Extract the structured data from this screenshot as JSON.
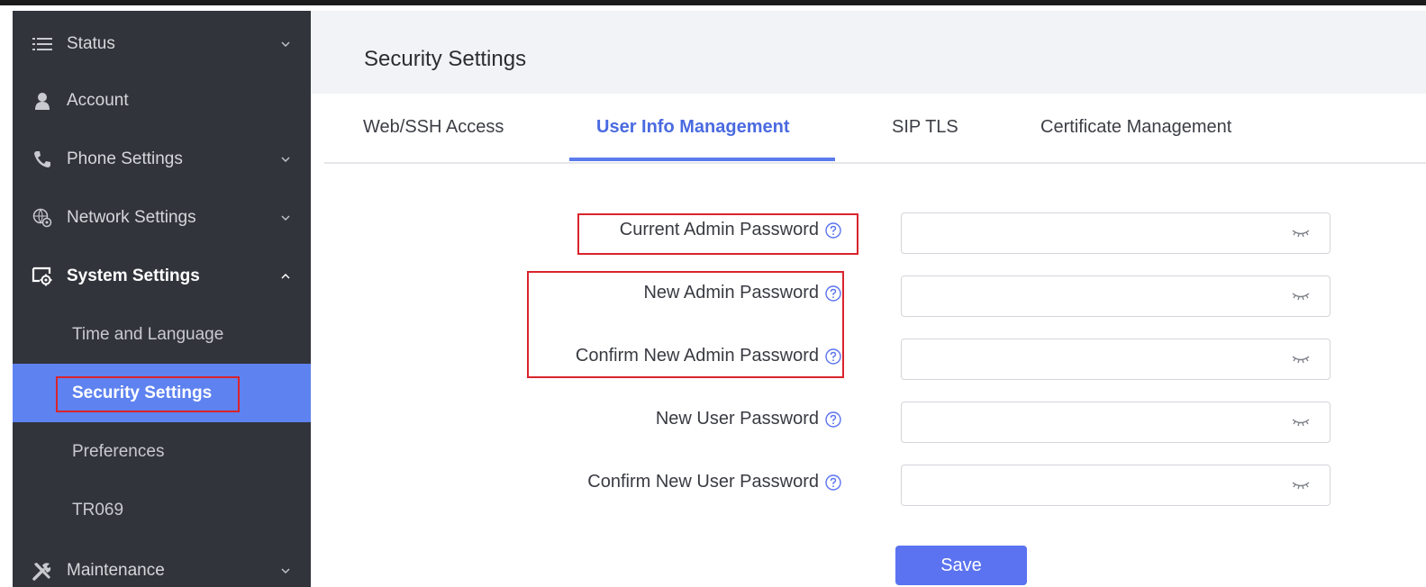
{
  "sidebar": {
    "items": [
      {
        "label": "Status",
        "icon": "list-icon",
        "has_chevron": true
      },
      {
        "label": "Account",
        "icon": "user-icon",
        "has_chevron": false
      },
      {
        "label": "Phone Settings",
        "icon": "phone-icon",
        "has_chevron": true
      },
      {
        "label": "Network Settings",
        "icon": "network-gear-icon",
        "has_chevron": true
      },
      {
        "label": "System Settings",
        "icon": "system-settings-icon",
        "has_chevron": true,
        "expanded": true
      },
      {
        "label": "Maintenance",
        "icon": "tools-icon",
        "has_chevron": true
      }
    ],
    "sub_items": [
      {
        "label": "Time and Language",
        "active": false
      },
      {
        "label": "Security Settings",
        "active": true
      },
      {
        "label": "Preferences",
        "active": false
      },
      {
        "label": "TR069",
        "active": false
      }
    ]
  },
  "header": {
    "title": "Security Settings"
  },
  "tabs": [
    {
      "label": "Web/SSH Access",
      "active": false
    },
    {
      "label": "User Info Management",
      "active": true
    },
    {
      "label": "SIP TLS",
      "active": false
    },
    {
      "label": "Certificate Management",
      "active": false
    }
  ],
  "form": {
    "fields": [
      {
        "label": "Current Admin Password",
        "value": ""
      },
      {
        "label": "New Admin Password",
        "value": ""
      },
      {
        "label": "Confirm New Admin Password",
        "value": ""
      },
      {
        "label": "New User Password",
        "value": ""
      },
      {
        "label": "Confirm New User Password",
        "value": ""
      }
    ],
    "save_label": "Save"
  },
  "colors": {
    "sidebar_bg": "#31343b",
    "active_item_bg": "#5e82ef",
    "accent": "#4a6ae0",
    "highlight_box": "#d9242c",
    "save_button": "#5b73f0"
  }
}
